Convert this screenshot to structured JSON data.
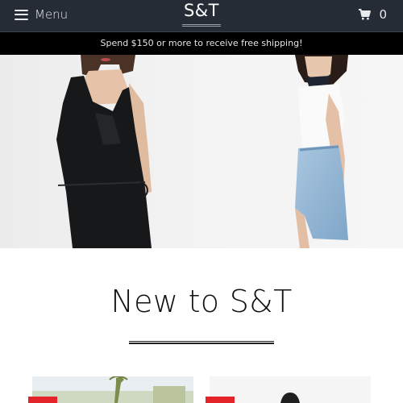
{
  "header": {
    "menu_label": "Menu",
    "logo_text": "S&T",
    "cart_count": "0",
    "icons": {
      "menu": "hamburger-icon",
      "cart": "shopping-cart-icon"
    }
  },
  "promo": {
    "text": "Spend $150 or more to receive free shipping!"
  },
  "section": {
    "title": "New to S&T"
  },
  "colors": {
    "header_bg": "#252c36",
    "promo_bg": "#000000",
    "sale_flag": "#e32428"
  }
}
